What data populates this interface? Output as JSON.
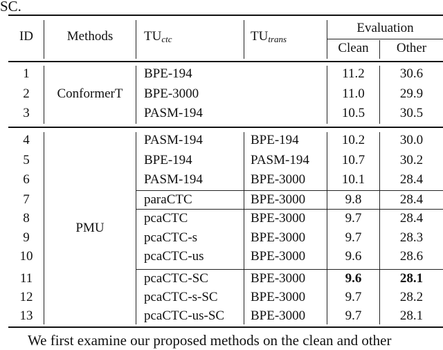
{
  "caption_tail": "SC.",
  "table": {
    "headers": {
      "id": "ID",
      "methods": "Methods",
      "tu_ctc": {
        "base": "TU",
        "sub": "ctc"
      },
      "tu_trans": {
        "base": "TU",
        "sub": "trans"
      },
      "evaluation": "Evaluation",
      "clean": "Clean",
      "other": "Other"
    },
    "groups": [
      {
        "method": "ConformerT",
        "rows": [
          {
            "id": "1",
            "tu_ctc": "BPE-194",
            "tu_trans": "",
            "clean": "11.2",
            "other": "30.6"
          },
          {
            "id": "2",
            "tu_ctc": "BPE-3000",
            "tu_trans": "",
            "clean": "11.0",
            "other": "29.9"
          },
          {
            "id": "3",
            "tu_ctc": "PASM-194",
            "tu_trans": "",
            "clean": "10.5",
            "other": "30.5"
          }
        ]
      },
      {
        "method": "PMU",
        "rows": [
          {
            "id": "4",
            "tu_ctc": "PASM-194",
            "tu_trans": "BPE-194",
            "clean": "10.2",
            "other": "30.0"
          },
          {
            "id": "5",
            "tu_ctc": "BPE-194",
            "tu_trans": "PASM-194",
            "clean": "10.7",
            "other": "30.2"
          },
          {
            "id": "6",
            "tu_ctc": "PASM-194",
            "tu_trans": "BPE-3000",
            "clean": "10.1",
            "other": "28.4"
          },
          {
            "id": "7",
            "tu_ctc": "paraCTC",
            "tu_trans": "BPE-3000",
            "clean": "9.8",
            "other": "28.4"
          },
          {
            "id": "8",
            "tu_ctc": "pcaCTC",
            "tu_trans": "BPE-3000",
            "clean": "9.7",
            "other": "28.4"
          },
          {
            "id": "9",
            "tu_ctc": "pcaCTC-s",
            "tu_trans": "BPE-3000",
            "clean": "9.7",
            "other": "28.3"
          },
          {
            "id": "10",
            "tu_ctc": "pcaCTC-us",
            "tu_trans": "BPE-3000",
            "clean": "9.6",
            "other": "28.6"
          },
          {
            "id": "11",
            "tu_ctc": "pcaCTC-SC",
            "tu_trans": "BPE-3000",
            "clean": "9.6",
            "other": "28.1",
            "bold": true
          },
          {
            "id": "12",
            "tu_ctc": "pcaCTC-s-SC",
            "tu_trans": "BPE-3000",
            "clean": "9.7",
            "other": "28.2"
          },
          {
            "id": "13",
            "tu_ctc": "pcaCTC-us-SC",
            "tu_trans": "BPE-3000",
            "clean": "9.7",
            "other": "28.1"
          }
        ]
      }
    ]
  },
  "paragraph_start": "We first examine our proposed methods on the clean and other"
}
